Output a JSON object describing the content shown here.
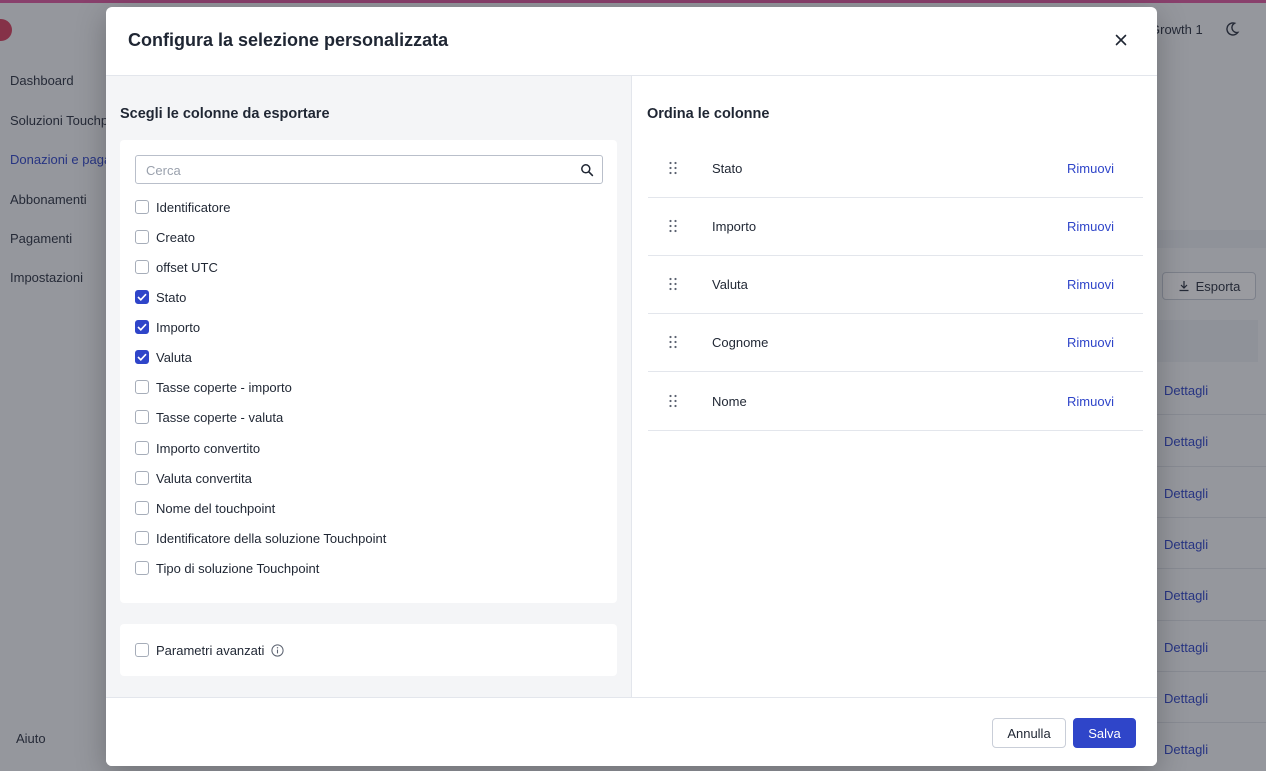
{
  "background": {
    "nav_items": [
      {
        "label": "Dashboard",
        "active": false
      },
      {
        "label": "Soluzioni Touchpoint",
        "active": false
      },
      {
        "label": "Donazioni e pagamenti",
        "active": true
      },
      {
        "label": "Abbonamenti",
        "active": false
      },
      {
        "label": "Pagamenti",
        "active": false
      },
      {
        "label": "Impostazioni",
        "active": false
      }
    ],
    "help_label": "Aiuto",
    "workspace_label": "Growth 1",
    "export_label": "Esporta",
    "detail_label": "Dettagli"
  },
  "modal": {
    "title": "Configura la selezione personalizzata",
    "left_title": "Scegli le colonne da esportare",
    "right_title": "Ordina le colonne",
    "search": {
      "placeholder": "Cerca",
      "value": ""
    },
    "columns": [
      {
        "label": "Identificatore",
        "checked": false
      },
      {
        "label": "Creato",
        "checked": false
      },
      {
        "label": "offset UTC",
        "checked": false
      },
      {
        "label": "Stato",
        "checked": true
      },
      {
        "label": "Importo",
        "checked": true
      },
      {
        "label": "Valuta",
        "checked": true
      },
      {
        "label": "Tasse coperte - importo",
        "checked": false
      },
      {
        "label": "Tasse coperte - valuta",
        "checked": false
      },
      {
        "label": "Importo convertito",
        "checked": false
      },
      {
        "label": "Valuta convertita",
        "checked": false
      },
      {
        "label": "Nome del touchpoint",
        "checked": false
      },
      {
        "label": "Identificatore della soluzione Touchpoint",
        "checked": false
      },
      {
        "label": "Tipo di soluzione Touchpoint",
        "checked": false
      }
    ],
    "advanced": {
      "label": "Parametri avanzati",
      "checked": false
    },
    "ordered_columns": [
      {
        "label": "Stato",
        "remove_label": "Rimuovi"
      },
      {
        "label": "Importo",
        "remove_label": "Rimuovi"
      },
      {
        "label": "Valuta",
        "remove_label": "Rimuovi"
      },
      {
        "label": "Cognome",
        "remove_label": "Rimuovi"
      },
      {
        "label": "Nome",
        "remove_label": "Rimuovi"
      }
    ],
    "footer": {
      "cancel_label": "Annulla",
      "save_label": "Salva"
    }
  },
  "colors": {
    "accent": "#2f45c9",
    "overlay": "#1e222c",
    "brand": "#e05aa0"
  }
}
